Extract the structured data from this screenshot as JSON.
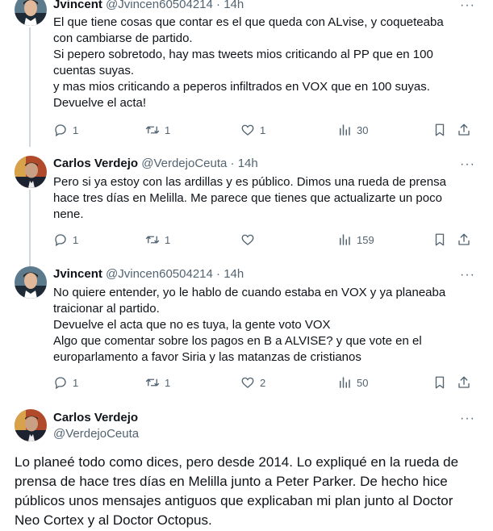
{
  "tweets": [
    {
      "author": "Jvincent",
      "handle": "@Jvincen60504214",
      "time": "14h",
      "lines": [
        "El que tiene cosas que contar es el que queda con ALvise, y coqueteaba",
        "con cambiarse de partido.",
        "Si pepero sobretodo, hay mas tweets mios criticando al PP que en 100",
        "cuentas suyas.",
        "y mas mios criticando a peperos infiltrados en VOX que en 100 suyas.",
        "Devuelve el acta!"
      ],
      "stats": {
        "replies": "1",
        "retweets": "1",
        "likes": "1",
        "views": "30"
      }
    },
    {
      "author": "Carlos Verdejo",
      "handle": "@VerdejoCeuta",
      "time": "14h",
      "lines": [
        "Pero si ya estoy con las ardillas y es público. Dimos una rueda de prensa",
        "hace tres días en Melilla. Me parece que tienes que actualizarte un poco",
        "nene."
      ],
      "stats": {
        "replies": "1",
        "retweets": "1",
        "likes": "",
        "views": "159"
      }
    },
    {
      "author": "Jvincent",
      "handle": "@Jvincen60504214",
      "time": "14h",
      "lines": [
        "No quiere entender, yo le hablo de cuando estaba en VOX y ya planeaba",
        "traicionar al partido.",
        "Devuelve el acta que no es tuya, la gente voto VOX",
        "Algo que comentar sobre los pagos en B a ALVISE? y que vote en el",
        "europarlamento a favor Siria y las matanzas de cristianos"
      ],
      "stats": {
        "replies": "1",
        "retweets": "1",
        "likes": "2",
        "views": "50"
      }
    }
  ],
  "main_tweet": {
    "author": "Carlos Verdejo",
    "handle": "@VerdejoCeuta",
    "lines": [
      "Lo planeé todo como dices, pero desde 2014. Lo expliqué en la rueda de",
      "prensa de hace tres días en Melilla junto a Peter Parker. De hecho hice",
      "públicos unos mensajes antiguos que explicaban mi plan junto al Doctor",
      "Neo Cortex y al Doctor Octopus."
    ]
  },
  "ui": {
    "dot": "·",
    "more": "···"
  },
  "colors": {
    "text": "#0f1419",
    "muted": "#536471",
    "thread": "#cfd9de"
  },
  "icons": [
    "reply-icon",
    "retweet-icon",
    "like-icon",
    "views-icon",
    "bookmark-icon",
    "share-icon",
    "more-icon"
  ]
}
